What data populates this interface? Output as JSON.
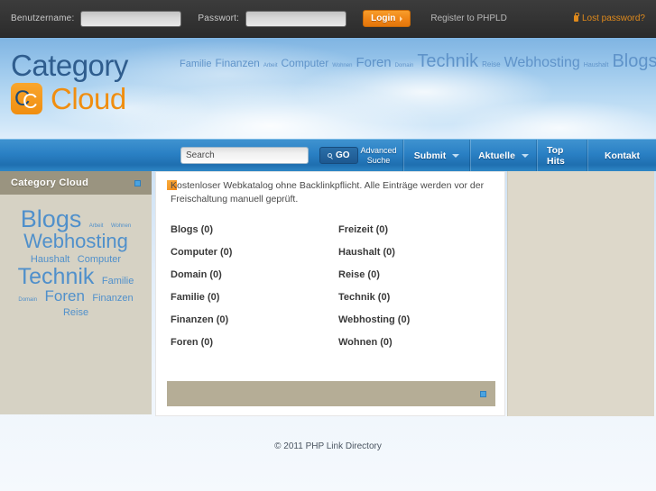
{
  "topbar": {
    "username_label": "Benutzername:",
    "username_value": "",
    "username_placeholder": "",
    "password_label": "Passwort:",
    "password_value": "",
    "password_placeholder": "",
    "login_label": "Login",
    "register_label": "Register to PHPLD",
    "lost_password_label": "Lost password?",
    "accent_color": "#ef8415"
  },
  "header": {
    "logo_line1": "Category",
    "logo_line2": "Cloud",
    "logo_mark_letter_dark": "C",
    "logo_mark_letter_light": "C",
    "logo_title_color": "#2f5d8e",
    "logo_cloud_color": "#f08e10",
    "cloud_tags": [
      {
        "label": "Familie",
        "size": 11
      },
      {
        "label": "Finanzen",
        "size": 12
      },
      {
        "label": "Arbeit",
        "size": 6
      },
      {
        "label": "Computer",
        "size": 12
      },
      {
        "label": "Wohnen",
        "size": 6
      },
      {
        "label": "Foren",
        "size": 15
      },
      {
        "label": "Domain",
        "size": 6
      },
      {
        "label": "Technik",
        "size": 20
      },
      {
        "label": "Reise",
        "size": 8
      },
      {
        "label": "Webhosting",
        "size": 16
      },
      {
        "label": "Haushalt",
        "size": 7
      },
      {
        "label": "Blogs",
        "size": 20
      }
    ]
  },
  "nav": {
    "search_value": "Search",
    "search_placeholder": "Search",
    "go_label": "GO",
    "advanced_line1": "Advanced",
    "advanced_line2": "Suche",
    "submit_label": "Submit",
    "aktuelle_label": "Aktuelle",
    "tophits_label": "Top Hits",
    "kontakt_label": "Kontakt"
  },
  "sidebar": {
    "title": "Category Cloud",
    "cloud_tags": [
      {
        "label": "Blogs",
        "size": 27
      },
      {
        "label": "Arbeit",
        "size": 6
      },
      {
        "label": "Wohnen",
        "size": 6
      },
      {
        "label": "Webhosting",
        "size": 22
      },
      {
        "label": "Haushalt",
        "size": 11
      },
      {
        "label": "Computer",
        "size": 11
      },
      {
        "label": "Technik",
        "size": 25
      },
      {
        "label": "Familie",
        "size": 11
      },
      {
        "label": "Domain",
        "size": 6
      },
      {
        "label": "Foren",
        "size": 17
      },
      {
        "label": "Finanzen",
        "size": 11
      },
      {
        "label": "Reise",
        "size": 11
      }
    ]
  },
  "main": {
    "intro_text": "Kostenloser Webkatalog ohne Backlinkpflicht. Alle Einträge werden vor der Freischaltung manuell geprüft.",
    "categories": [
      {
        "label": "Blogs (0)"
      },
      {
        "label": "Freizeit (0)"
      },
      {
        "label": "Computer (0)"
      },
      {
        "label": "Haushalt (0)"
      },
      {
        "label": "Domain (0)"
      },
      {
        "label": "Reise (0)"
      },
      {
        "label": "Familie (0)"
      },
      {
        "label": "Technik (0)"
      },
      {
        "label": "Finanzen (0)"
      },
      {
        "label": "Webhosting (0)"
      },
      {
        "label": "Foren (0)"
      },
      {
        "label": "Wohnen (0)"
      }
    ]
  },
  "footer": {
    "copyright": "© 2011 PHP Link Directory"
  }
}
